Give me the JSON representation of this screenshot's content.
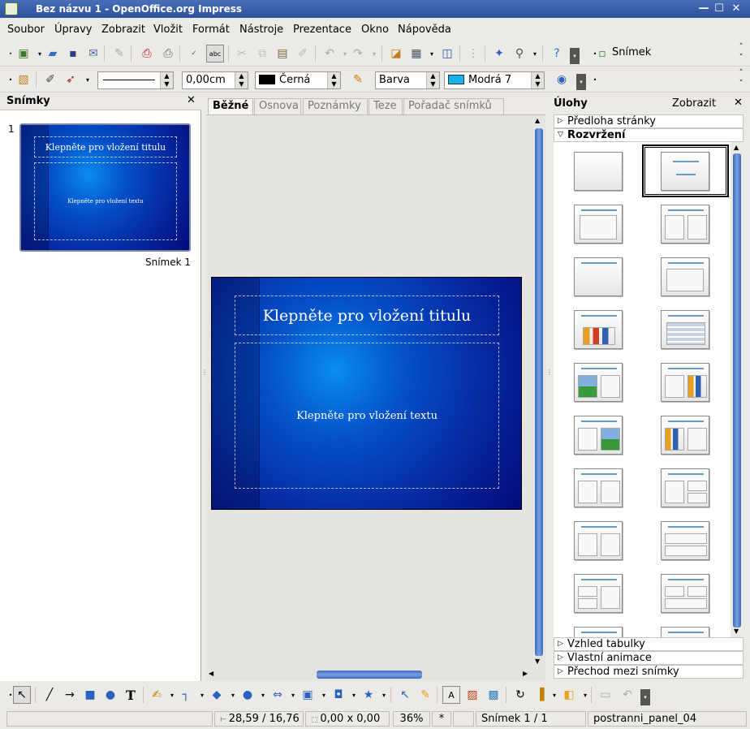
{
  "window": {
    "title": "Bez názvu 1 - OpenOffice.org Impress",
    "min": "—",
    "max": "☐",
    "close": "✕"
  },
  "menu": [
    "Soubor",
    "Úpravy",
    "Zobrazit",
    "Vložit",
    "Formát",
    "Nástroje",
    "Prezentace",
    "Okno",
    "Nápověda"
  ],
  "toolbar1": {
    "new_slide": "Snímek"
  },
  "toolbar2": {
    "line_width": "0,00cm",
    "line_color": "Černá",
    "area_style": "Barva",
    "area_color": "Modrá 7"
  },
  "colors": {
    "line_color": "#000000",
    "area_color": "#14b4f0"
  },
  "slides_panel": {
    "title": "Snímky",
    "close": "✕",
    "items": [
      {
        "number": "1",
        "name": "Snímek 1",
        "title_ph": "Klepněte pro vložení titulu",
        "text_ph": "Klepněte pro vložení textu"
      }
    ]
  },
  "tabs": [
    "Běžné",
    "Osnova",
    "Poznámky",
    "Teze",
    "Pořadač snímků"
  ],
  "slide": {
    "title_ph": "Klepněte pro vložení titulu",
    "text_ph": "Klepněte pro vložení textu"
  },
  "tasks": {
    "title": "Úlohy",
    "view": "Zobrazit",
    "close": "✕",
    "sections_top": [
      "Předloha stránky",
      "Rozvržení"
    ],
    "sections_bottom": [
      "Vzhled tabulky",
      "Vlastní animace",
      "Přechod mezi snímky"
    ]
  },
  "status": {
    "position": "28,59 / 16,76",
    "size": "0,00 x 0,00",
    "zoom": "36%",
    "modified": "*",
    "slide": "Snímek 1 / 1",
    "master": "postranni_panel_04"
  }
}
